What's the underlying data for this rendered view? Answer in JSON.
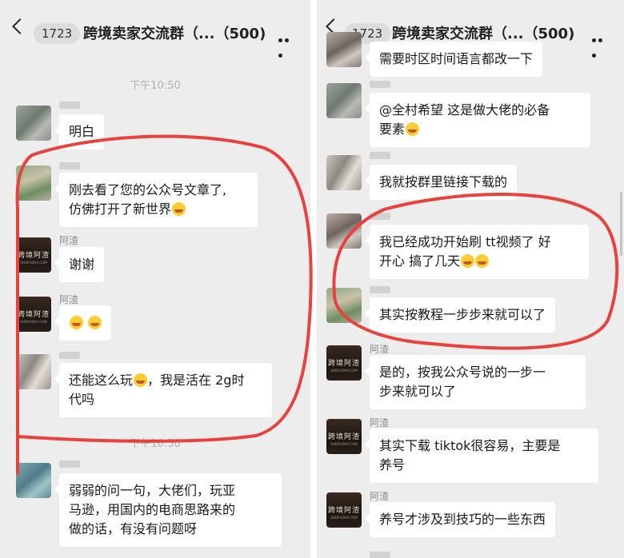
{
  "left": {
    "header": {
      "count": "1723",
      "title": "跨境卖家交流群（...（500)"
    },
    "times": [
      "下午10:50",
      "下午10:50"
    ],
    "messages": [
      {
        "sender": "",
        "text": "明白"
      },
      {
        "sender": "",
        "text_lines": [
          "刚去看了您的公众号文章了,",
          "仿佛打开了新世界"
        ]
      },
      {
        "sender": "阿渣",
        "text": "谢谢"
      },
      {
        "sender": "阿渣",
        "text": ""
      },
      {
        "sender": "",
        "text_lines": [
          "还能这么玩",
          "，我是活在 2g时",
          "代吗"
        ]
      },
      {
        "sender": "",
        "text_lines": [
          "弱弱的问一句，大佬们，玩亚",
          "马逊，用国内的电商思路来的",
          "做的话，有没有问题呀"
        ]
      }
    ]
  },
  "right": {
    "header": {
      "count": "1723",
      "title": "跨境卖家交流群（...（500)"
    },
    "messages": [
      {
        "sender": "",
        "text": "需要时区时间语言都改一下"
      },
      {
        "sender": "",
        "text_lines": [
          "@全村希望 这是做大佬的必备",
          "要素"
        ]
      },
      {
        "sender": "",
        "text": "我就按群里链接下载的"
      },
      {
        "sender": "",
        "text_lines": [
          "我已经成功开始刷 tt视频了 好",
          "开心 搞了几天"
        ]
      },
      {
        "sender": "",
        "text": "其实按教程一步步来就可以了"
      },
      {
        "sender": "阿渣",
        "text_lines": [
          "是的，按我公众号说的一步一",
          "步来就可以了"
        ]
      },
      {
        "sender": "阿渣",
        "text_lines": [
          "其实下载 tiktok很容易，主要是",
          "养号"
        ]
      },
      {
        "sender": "阿渣",
        "text": "养号才涉及到技巧的一些东西"
      }
    ]
  },
  "avatar_brand": {
    "line1": "跨境阿渣",
    "line2": "SHOP.AZHA.COM"
  },
  "colors": {
    "background": "#ededed",
    "bubble": "#ffffff",
    "annotation": "#e8423f"
  }
}
